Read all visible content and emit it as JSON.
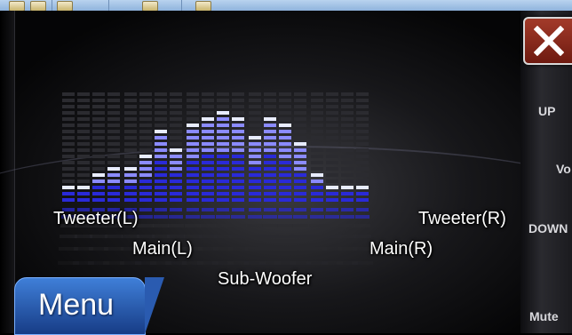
{
  "window": {
    "close_icon": "close-icon"
  },
  "equalizer": {
    "channels": [
      {
        "label": "Tweeter(L)",
        "levels": [
          3,
          3,
          5,
          6
        ]
      },
      {
        "label": "Main(L)",
        "levels": [
          6,
          8,
          12,
          9
        ]
      },
      {
        "label": "Sub-Woofer",
        "levels": [
          13,
          14,
          15,
          14
        ]
      },
      {
        "label": "Main(R)",
        "levels": [
          11,
          14,
          13,
          10
        ]
      },
      {
        "label": "Tweeter(R)",
        "levels": [
          5,
          3,
          3,
          3
        ]
      }
    ],
    "max_level": 18,
    "colors": {
      "lit_top": "#e8ecff",
      "lit_mid": "#8b8bff",
      "lit_bottom": "#2a2ad8",
      "unlit": "#2b2b30"
    }
  },
  "side_controls": {
    "up_label": "UP",
    "vol_label": "Vo",
    "down_label": "DOWN",
    "mute_label": "Mute"
  },
  "menu": {
    "label": "Menu"
  }
}
